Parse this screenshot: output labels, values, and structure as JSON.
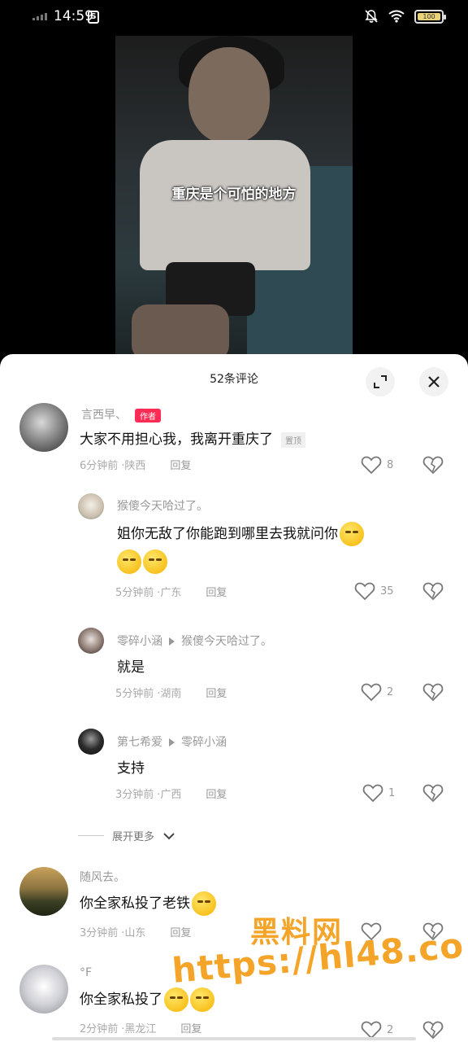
{
  "status_bar": {
    "time": "14:59",
    "app_icon": "S",
    "battery": "100"
  },
  "video": {
    "caption": "重庆是个可怕的地方"
  },
  "panel": {
    "title": "52条评论"
  },
  "comments": [
    {
      "user": "言西早、",
      "author_tag": "作者",
      "text": "大家不用担心我，我离开重庆了",
      "top_tag": "置顶",
      "time": "6分钟前",
      "location": "·陕西",
      "reply": "回复",
      "likes": "8"
    },
    {
      "user": "猴傻今天哈过了。",
      "text_line1": "姐你无敌了你能跑到哪里去我就问你",
      "time": "5分钟前",
      "location": "·广东",
      "reply": "回复",
      "likes": "35"
    },
    {
      "user": "零碎小涵",
      "reply_to": "猴傻今天哈过了。",
      "text": "就是",
      "time": "5分钟前",
      "location": "·湖南",
      "reply": "回复",
      "likes": "2"
    },
    {
      "user": "第七希爱",
      "reply_to": "零碎小涵",
      "text": "支持",
      "time": "3分钟前",
      "location": "·广西",
      "reply": "回复",
      "likes": "1"
    },
    {
      "user": "随风去。",
      "text": "你全家私投了老铁",
      "time": "3分钟前",
      "location": "·山东",
      "reply": "回复"
    },
    {
      "user": "°F",
      "text": "你全家私投了",
      "time": "2分钟前",
      "location": "·黑龙江",
      "reply": "回复",
      "likes": "2"
    }
  ],
  "expand_more": "展开更多",
  "watermark": {
    "line1": "黑料网",
    "line2": "https://hl48.co"
  },
  "colors": {
    "author_tag": "#fe2c55",
    "panel_bg": "#ffffff",
    "watermark": "#f39c12"
  }
}
